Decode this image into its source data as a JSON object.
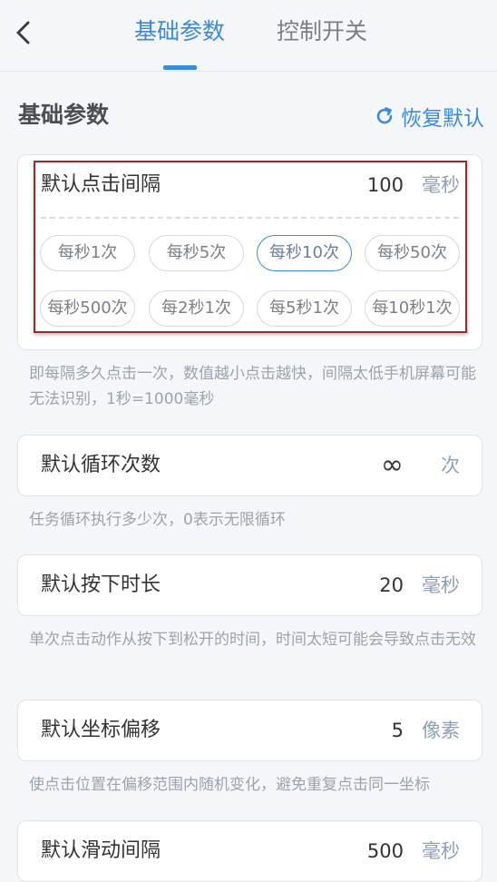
{
  "header": {
    "tabs": [
      {
        "label": "基础参数",
        "active": true
      },
      {
        "label": "控制开关",
        "active": false
      }
    ]
  },
  "section": {
    "title": "基础参数",
    "restore_label": "恢复默认"
  },
  "interval": {
    "label": "默认点击间隔",
    "value": "100",
    "unit": "毫秒",
    "presets": [
      "每秒1次",
      "每秒5次",
      "每秒10次",
      "每秒50次",
      "每秒500次",
      "每2秒1次",
      "每5秒1次",
      "每10秒1次"
    ],
    "selected_preset": "每秒10次",
    "hint": "即每隔多久点击一次，数值越小点击越快，间隔太低手机屏幕可能无法识别，1秒=1000毫秒"
  },
  "loop": {
    "label": "默认循环次数",
    "value": "∞",
    "unit": "次",
    "hint": "任务循环执行多少次，0表示无限循环"
  },
  "press": {
    "label": "默认按下时长",
    "value": "20",
    "unit": "毫秒",
    "hint": "单次点击动作从按下到松开的时间，时间太短可能会导致点击无效"
  },
  "offset": {
    "label": "默认坐标偏移",
    "value": "5",
    "unit": "像素",
    "hint": "使点击位置在偏移范围内随机变化，避免重复点击同一坐标"
  },
  "swipe": {
    "label": "默认滑动间隔",
    "value": "500",
    "unit": "毫秒"
  },
  "colors": {
    "accent": "#3d8bd6",
    "hint": "#9aa3ae",
    "unit": "#8fa0b5"
  }
}
